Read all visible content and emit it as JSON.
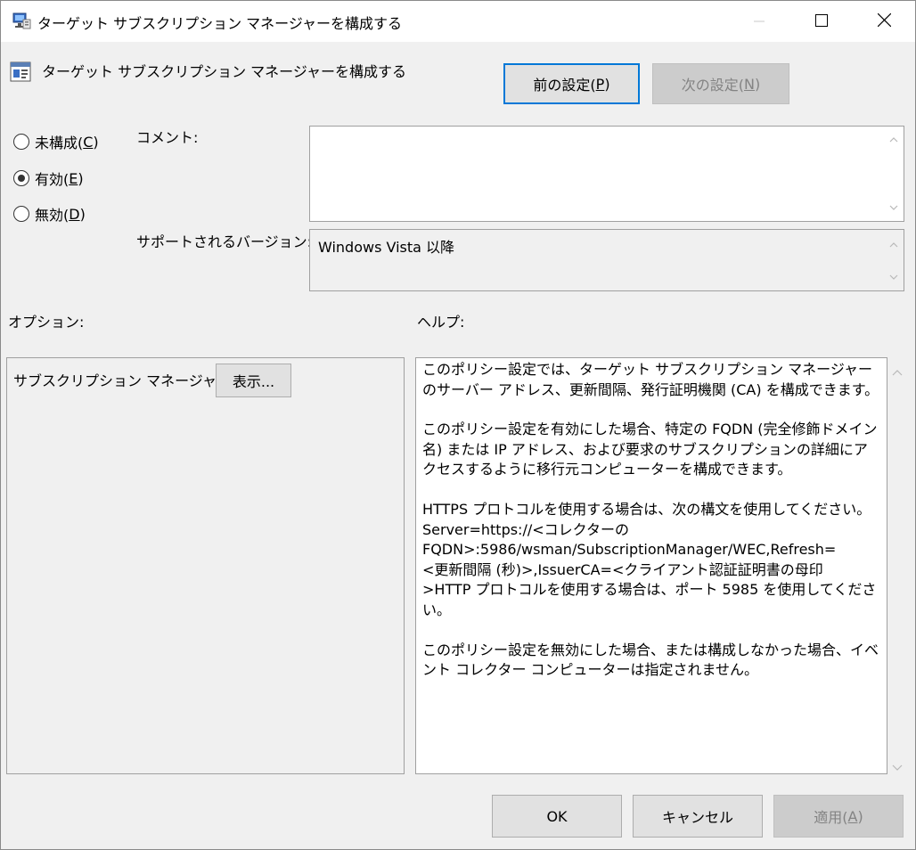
{
  "window": {
    "title": "ターゲット サブスクリプション マネージャーを構成する",
    "caption_buttons": [
      "minimize-icon",
      "maximize-icon",
      "close-icon"
    ]
  },
  "header": {
    "policy_title": "ターゲット サブスクリプション マネージャーを構成する",
    "prev_button": {
      "label": "前の設定(",
      "accel": "P",
      "suffix": ")"
    },
    "next_button": {
      "label": "次の設定(",
      "accel": "N",
      "suffix": ")"
    }
  },
  "state": {
    "options": [
      {
        "label": "未構成(",
        "accel": "C",
        "suffix": ")",
        "selected": false
      },
      {
        "label": "有効(",
        "accel": "E",
        "suffix": ")",
        "selected": true
      },
      {
        "label": "無効(",
        "accel": "D",
        "suffix": ")",
        "selected": false
      }
    ]
  },
  "comment": {
    "label": "コメント:",
    "value": ""
  },
  "supported": {
    "label": "サポートされるバージョン:",
    "value": "Windows Vista 以降"
  },
  "options_section": {
    "label": "オプション:",
    "subscription_manager_label": "サブスクリプション マネージャー",
    "show_button": "表示..."
  },
  "help_section": {
    "label": "ヘルプ:",
    "paragraphs": [
      "このポリシー設定では、ターゲット サブスクリプション マネージャーのサーバー アドレス、更新間隔、発行証明機関 (CA) を構成できます。",
      "このポリシー設定を有効にした場合、特定の FQDN (完全修飾ドメイン名) または IP アドレス、および要求のサブスクリプションの詳細にアクセスするように移行元コンピューターを構成できます。",
      "HTTPS プロトコルを使用する場合は、次の構文を使用してください。\nServer=https://<コレクターの\nFQDN>:5986/wsman/SubscriptionManager/WEC,Refresh=\n<更新間隔 (秒)>,IssuerCA=<クライアント認証証明書の母印\n>HTTP プロトコルを使用する場合は、ポート 5985 を使用してください。",
      "このポリシー設定を無効にした場合、または構成しなかった場合、イベント コレクター コンピューターは指定されません。"
    ]
  },
  "footer": {
    "ok_button": "OK",
    "cancel_button": "キャンセル",
    "apply_button": {
      "label": "適用(",
      "accel": "A",
      "suffix": ")"
    }
  },
  "colors": {
    "accent": "#0078d7",
    "window_bg": "#f0f0f0",
    "disabled_text": "#838383"
  }
}
